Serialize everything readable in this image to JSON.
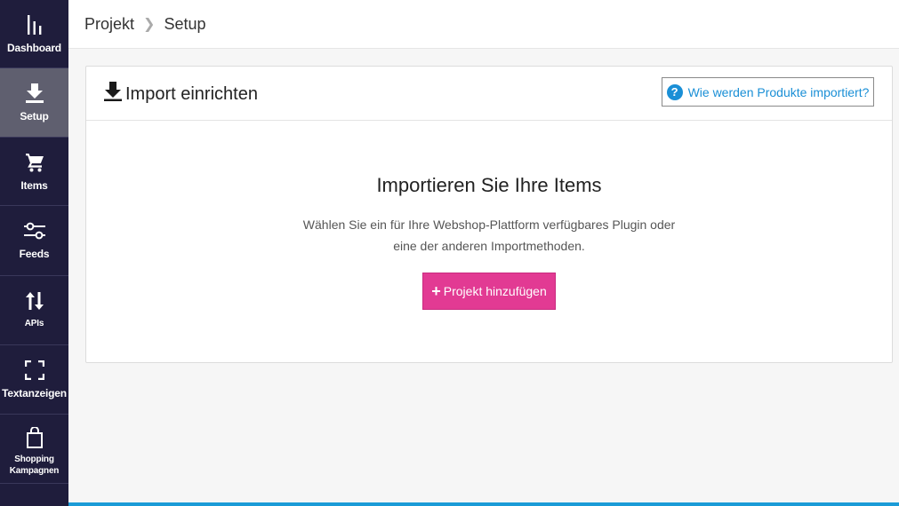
{
  "sidebar": {
    "items": [
      {
        "label": "Dashboard",
        "icon": "chart-bars-icon",
        "active": false
      },
      {
        "label": "Setup",
        "icon": "download-icon",
        "active": true
      },
      {
        "label": "Items",
        "icon": "shopping-cart-icon",
        "active": false
      },
      {
        "label": "Feeds",
        "icon": "sliders-icon",
        "active": false
      },
      {
        "label": "APIs",
        "icon": "up-down-arrows-icon",
        "active": false
      },
      {
        "label": "Textanzeigen",
        "icon": "frame-corners-icon",
        "active": false
      },
      {
        "label_line1": "Shopping",
        "label_line2": "Kampagnen",
        "icon": "shopping-bag-icon",
        "active": false
      }
    ]
  },
  "breadcrumb": {
    "items": [
      "Projekt",
      "Setup"
    ]
  },
  "card": {
    "title": "Import einrichten",
    "help_button": "Wie werden Produkte importiert?",
    "headline": "Importieren Sie Ihre Items",
    "description_line1": "Wählen Sie ein für Ihre Webshop-Plattform verfügbares Plugin oder",
    "description_line2": "eine der anderen Importmethoden.",
    "add_button": "Projekt hinzufügen"
  },
  "colors": {
    "sidebar_bg": "#1f1d3c",
    "sidebar_active": "#5f5f6f",
    "accent_pink": "#e23a93",
    "link_blue": "#1a8fd6"
  }
}
